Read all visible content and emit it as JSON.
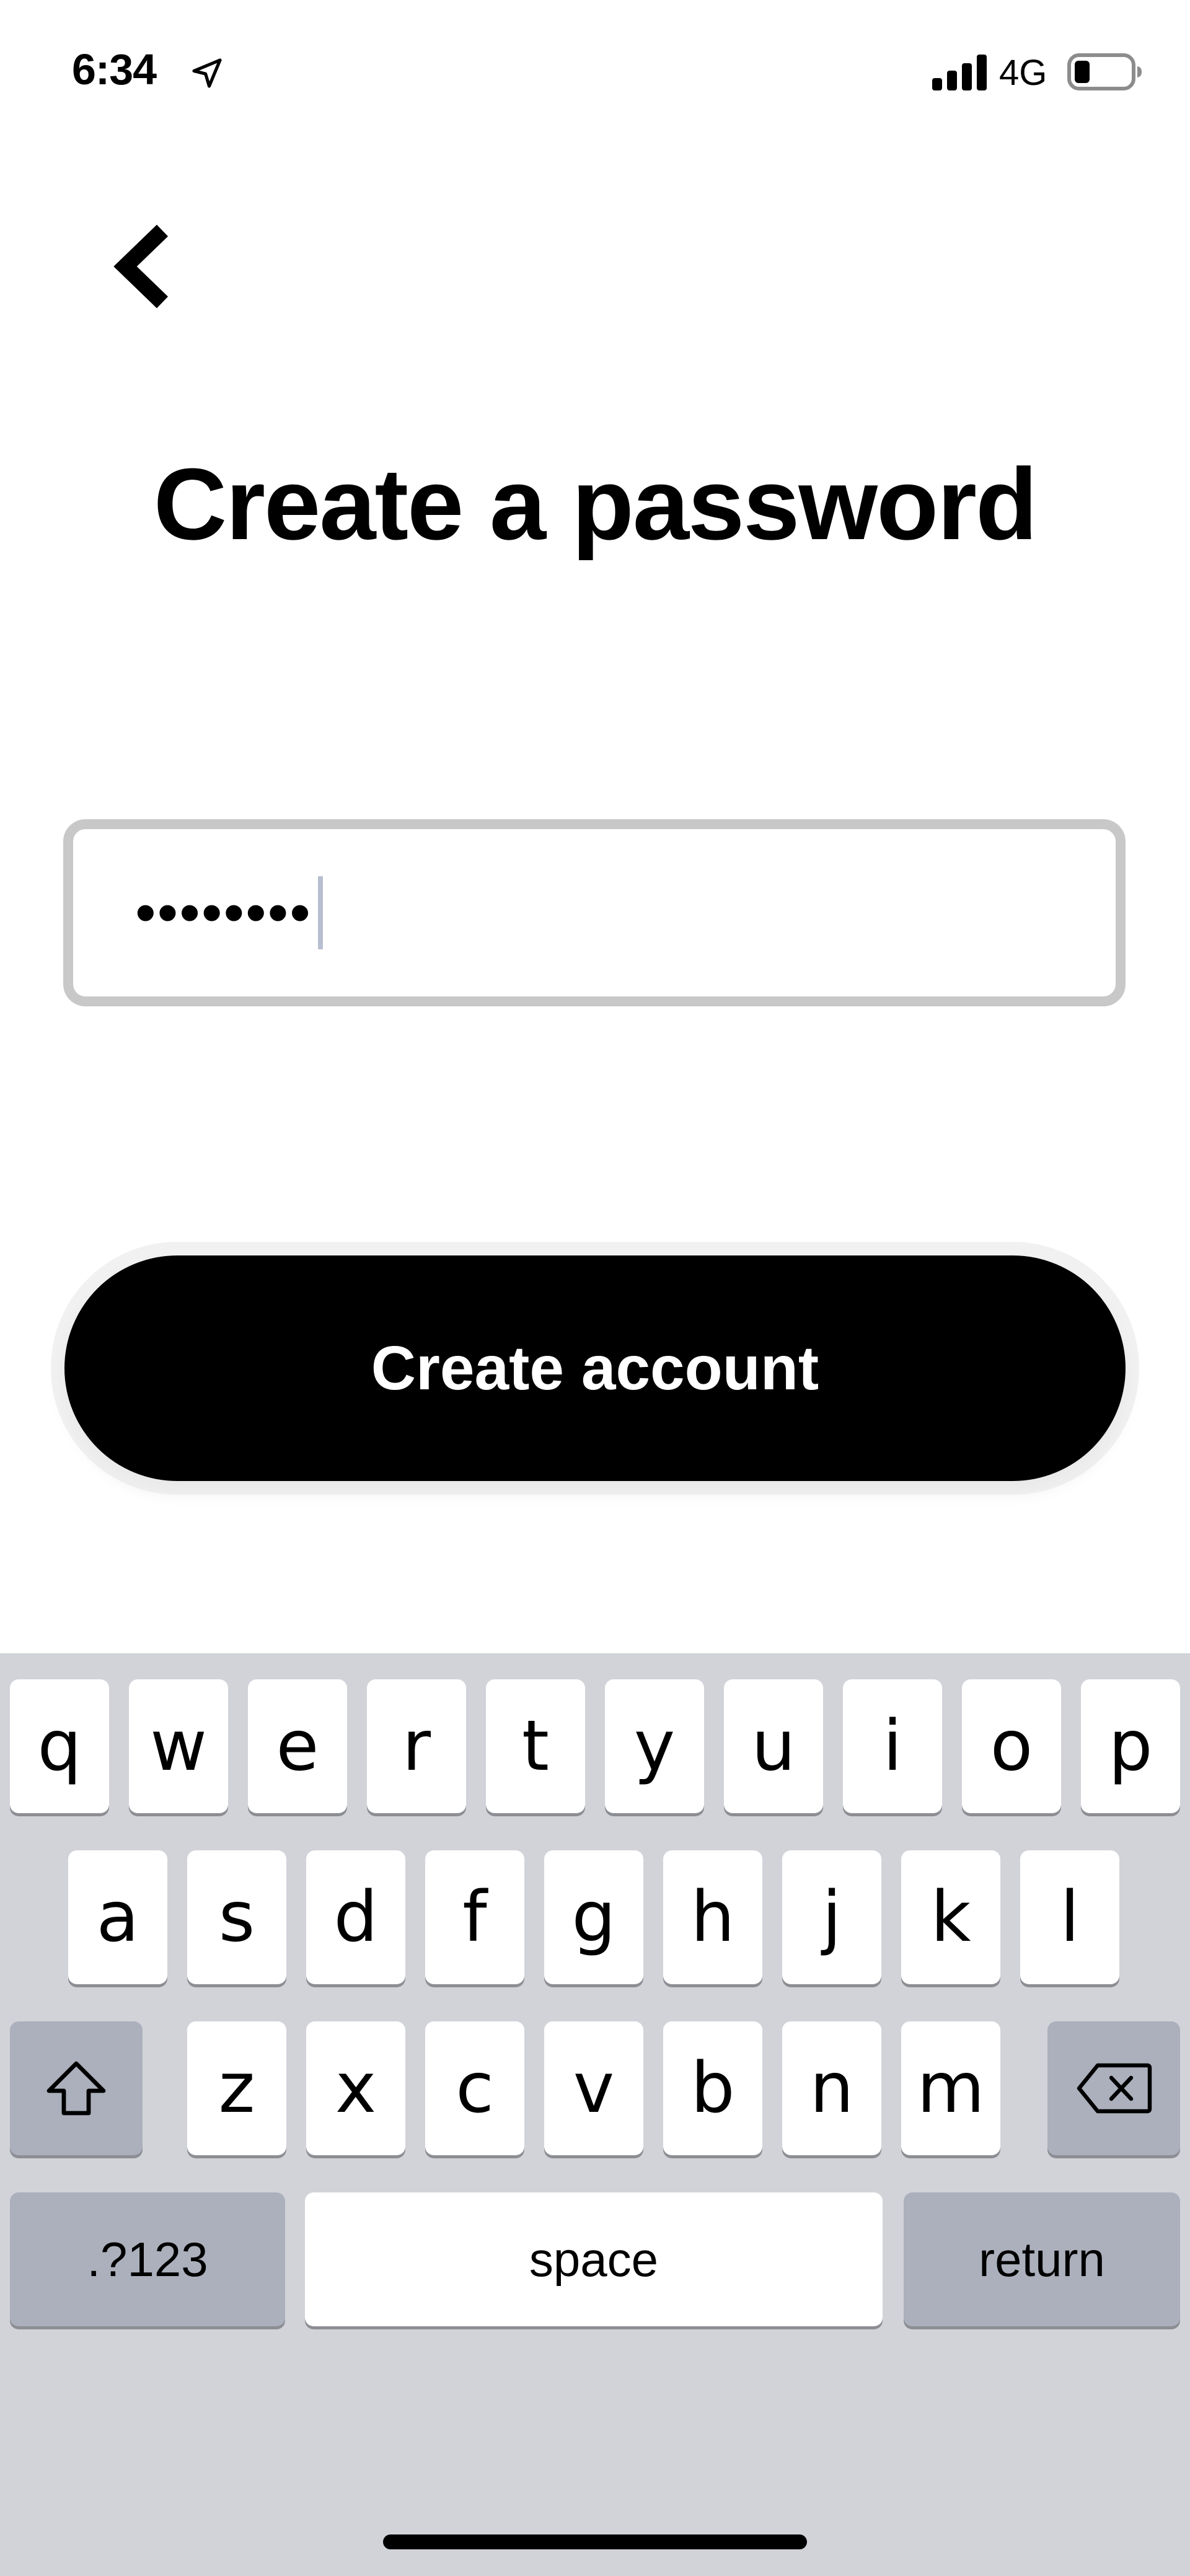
{
  "status_bar": {
    "time": "6:34",
    "network": "4G",
    "icons": [
      "location-arrow-icon",
      "signal-bars-icon",
      "battery-icon"
    ]
  },
  "header": {
    "back_icon": "chevron-left-icon",
    "title": "Create a password"
  },
  "password_field": {
    "value": "••••••••"
  },
  "primary_button": {
    "label": "Create account"
  },
  "keyboard": {
    "row1": [
      "q",
      "w",
      "e",
      "r",
      "t",
      "y",
      "u",
      "i",
      "o",
      "p"
    ],
    "row2": [
      "a",
      "s",
      "d",
      "f",
      "g",
      "h",
      "j",
      "k",
      "l"
    ],
    "row3": [
      "z",
      "x",
      "c",
      "v",
      "b",
      "n",
      "m"
    ],
    "shift_icon": "shift-arrow-icon",
    "delete_icon": "backspace-icon",
    "numbers_label": ".?123",
    "space_label": "space",
    "return_label": "return"
  },
  "colors": {
    "button_bg": "#000000",
    "field_border": "#c8c8c8",
    "keyboard_bg": "#d1d3d9",
    "dark_key": "#abb0bc"
  }
}
